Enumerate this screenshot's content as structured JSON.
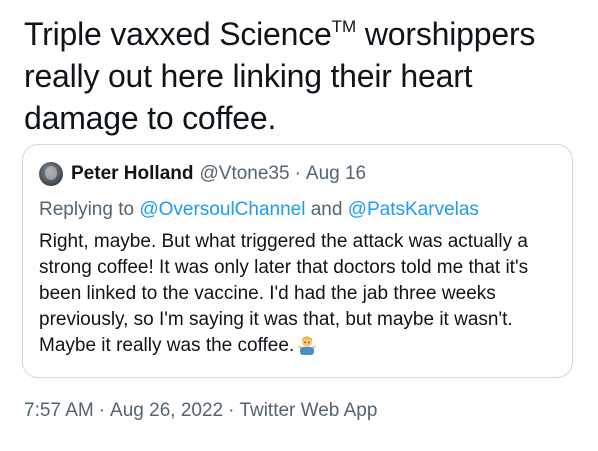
{
  "tweet": {
    "text_line1_part1": "Triple vaxxed Science",
    "text_tm": "TM",
    "text_line1_part2": " worshippers",
    "text_rest": "really out here linking their heart damage to coffee.",
    "timestamp_time": "7:57 AM",
    "timestamp_date": "Aug 26, 2022",
    "source": "Twitter Web App",
    "separator": "·"
  },
  "quoted_tweet": {
    "display_name": "Peter Holland",
    "handle": "@Vtone35",
    "date": "Aug 16",
    "replying_prefix": "Replying to ",
    "replying_mentions": [
      "@OversoulChannel",
      "@PatsKarvelas"
    ],
    "replying_conjunction": " and ",
    "body": "Right, maybe. But what triggered the attack was actually a strong coffee! It was only later that doctors told me that it's been linked to the vaccine. I'd had the jab three weeks previously, so I'm saying it was that, but maybe it wasn't. Maybe it really was the coffee.",
    "emoji": "man-shrugging-emoji"
  },
  "colors": {
    "text_primary": "#0f1419",
    "text_secondary": "#536471",
    "link": "#1d9bf0",
    "border": "#cfd9de"
  }
}
